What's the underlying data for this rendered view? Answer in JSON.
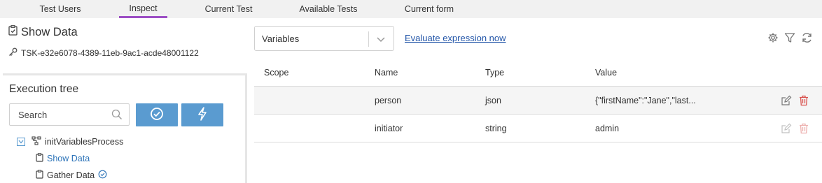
{
  "tabs": [
    {
      "label": "Test Users",
      "active": false
    },
    {
      "label": "Inspect",
      "active": true
    },
    {
      "label": "Current Test",
      "active": false
    },
    {
      "label": "Available Tests",
      "active": false
    },
    {
      "label": "Current form",
      "active": false
    }
  ],
  "left": {
    "title": "Show Data",
    "task_id": "TSK-e32e6078-4389-11eb-9ac1-acde48001122",
    "exec_tree": {
      "title": "Execution tree",
      "search_placeholder": "Search",
      "items": [
        {
          "label": "initVariablesProcess",
          "icon": "process-icon",
          "checked": true
        },
        {
          "label": "Show Data",
          "icon": "clipboard-icon",
          "selected": true
        },
        {
          "label": "Gather Data",
          "icon": "clipboard-icon",
          "completed": true
        }
      ]
    }
  },
  "toolbar": {
    "select_value": "Variables",
    "evaluate_link": "Evaluate expression now"
  },
  "table": {
    "headers": [
      "Scope",
      "Name",
      "Type",
      "Value"
    ],
    "rows": [
      {
        "scope": "",
        "name": "person",
        "type": "json",
        "value": "{\"firstName\":\"Jane\",\"last..."
      },
      {
        "scope": "",
        "name": "initiator",
        "type": "string",
        "value": "admin"
      }
    ]
  },
  "colors": {
    "accent_tab": "#9c4ec4",
    "button_blue": "#5a9bd0",
    "link_blue": "#2255a8",
    "delete_red": "#d9534f"
  }
}
